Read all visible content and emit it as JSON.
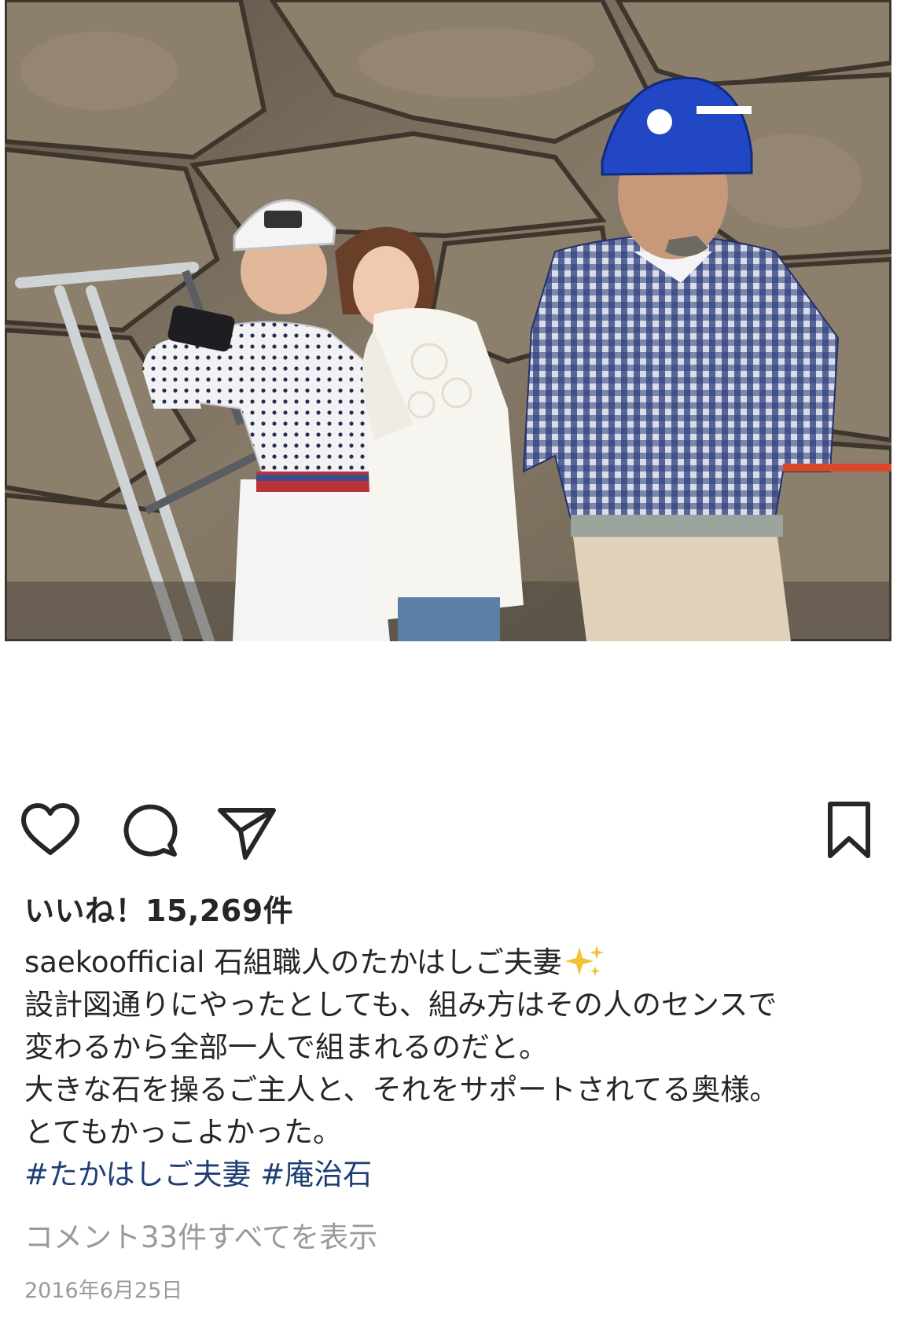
{
  "post": {
    "likes_text": "いいね！15,269件",
    "username": "saekoofficial",
    "caption_line1": "石組職人のたかはしご夫妻",
    "caption_lines": [
      "設計図通りにやったとしても、組み方はその人のセンスで",
      "変わるから全部一人で組まれるのだと。",
      "大きな石を操るご主人と、それをサポートされてる奥様。",
      "とてもかっこよかった。"
    ],
    "hashtags": [
      "#たかはしご夫妻",
      "#庵治石"
    ],
    "view_comments": "コメント33件すべてを表示",
    "date": "2016年6月25日"
  },
  "icons": {
    "like": "heart-icon",
    "comment": "comment-bubble-icon",
    "share": "paper-plane-icon",
    "save": "bookmark-icon",
    "sparkle": "sparkles-emoji"
  },
  "colors": {
    "text": "#262626",
    "muted": "#9a9a9a",
    "hashtag": "#1f3f74",
    "sparkle": "#f2c233"
  }
}
